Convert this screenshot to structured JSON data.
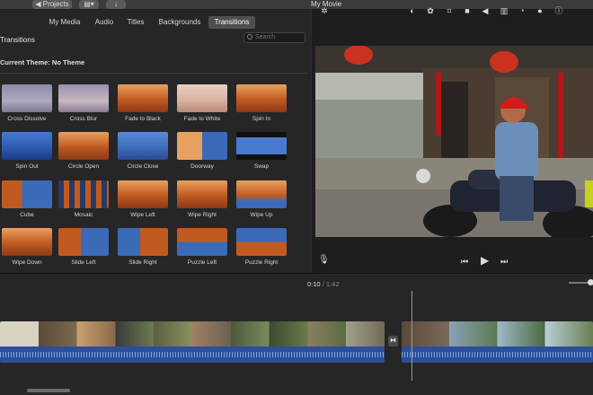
{
  "titlebar": {
    "back_label": "◀ Projects",
    "window_title": "My Movie"
  },
  "browser": {
    "tabs": [
      {
        "label": "My Media"
      },
      {
        "label": "Audio"
      },
      {
        "label": "Titles"
      },
      {
        "label": "Backgrounds"
      },
      {
        "label": "Transitions",
        "active": true
      }
    ],
    "title": "Transitions",
    "search_placeholder": "Search",
    "theme_label": "Current Theme: No Theme",
    "transitions": [
      {
        "label": "Cross Dissolve",
        "style": "mist"
      },
      {
        "label": "Cross Blur",
        "style": "blur"
      },
      {
        "label": "Fade to Black",
        "style": "forest"
      },
      {
        "label": "Fade to White",
        "style": "mistlight"
      },
      {
        "label": "Spin In",
        "style": "forestspin"
      },
      {
        "label": "Spin Out",
        "style": "bluespin"
      },
      {
        "label": "Circle Open",
        "style": "mountaincircle"
      },
      {
        "label": "Circle Close",
        "style": "forestcircle"
      },
      {
        "label": "Doorway",
        "style": "doorway"
      },
      {
        "label": "Swap",
        "style": "swap"
      },
      {
        "label": "Cube",
        "style": "cube"
      },
      {
        "label": "Mosaic",
        "style": "mosaic"
      },
      {
        "label": "Wipe Left",
        "style": "forest"
      },
      {
        "label": "Wipe Right",
        "style": "forest"
      },
      {
        "label": "Wipe Up",
        "style": "forestblue"
      },
      {
        "label": "Wipe Down",
        "style": "forest"
      },
      {
        "label": "Slide Left",
        "style": "slide"
      },
      {
        "label": "Slide Right",
        "style": "slider"
      },
      {
        "label": "Puzzle Left",
        "style": "puzzle"
      },
      {
        "label": "Puzzle Right",
        "style": "puzzler"
      }
    ]
  },
  "viewer": {
    "toolbar_icons": [
      "magic-wand",
      "color-balance",
      "color-correction",
      "crop",
      "stabilization",
      "volume",
      "noise-reduction",
      "speed",
      "clip-filter",
      "info"
    ],
    "controls": [
      "skip-back",
      "play",
      "skip-forward"
    ],
    "mic_icon": "microphone"
  },
  "timeline": {
    "current_time": "0:10",
    "separator": "/",
    "total_time": "1:42"
  },
  "colors": {
    "accent_blue": "#2b4f9a",
    "tile_orange": "#c8601e",
    "tile_blue": "#3f6fc4"
  }
}
